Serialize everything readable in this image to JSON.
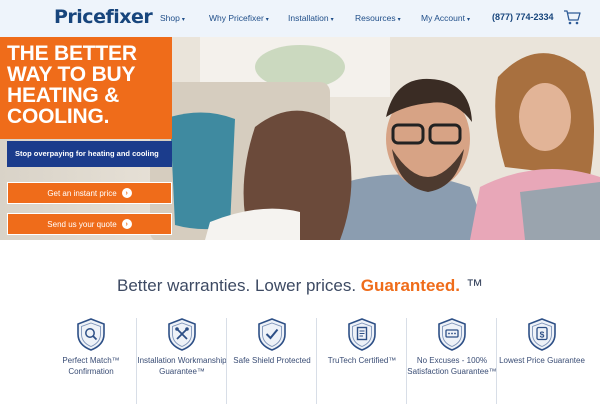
{
  "nav": {
    "logo": "Pricefixer",
    "links": [
      {
        "label": "Shop",
        "caret": "▾"
      },
      {
        "label": "Why Pricefixer",
        "caret": "▾"
      },
      {
        "label": "Installation",
        "caret": "▾"
      },
      {
        "label": "Resources",
        "caret": "▾"
      },
      {
        "label": "My Account",
        "caret": "▾"
      }
    ],
    "phone": "(877) 774-2334",
    "cart_icon": "cart-icon"
  },
  "hero": {
    "headline": [
      "THE BETTER",
      "WAY TO BUY",
      "HEATING &",
      "COOLING."
    ],
    "subhead": "Stop overpaying for heating and cooling",
    "cta_primary": "Get an instant price",
    "cta_secondary": "Send us your quote",
    "cta_arrow": "›",
    "image": "family-on-couch-photo"
  },
  "tagline": {
    "text": "Better warranties. Lower prices.",
    "accent": "Guaranteed.",
    "mark": "™"
  },
  "features": [
    {
      "label": "Perfect Match™ Confirmation",
      "icon": "magnifier-shield-icon"
    },
    {
      "label": "Installation Workmanship Guarantee™",
      "icon": "tools-shield-icon"
    },
    {
      "label": "Safe Shield Protected",
      "icon": "check-shield-icon"
    },
    {
      "label": "TruTech Certified™",
      "icon": "certificate-shield-icon"
    },
    {
      "label": "No Excuses - 100% Satisfaction Guarantee™",
      "icon": "stars-shield-icon"
    },
    {
      "label": "Lowest Price Guarantee",
      "icon": "dollar-shield-icon"
    }
  ],
  "colors": {
    "brand_orange": "#ef6c1a",
    "brand_navy": "#1b3c8c",
    "nav_background": "#eef4fb"
  }
}
